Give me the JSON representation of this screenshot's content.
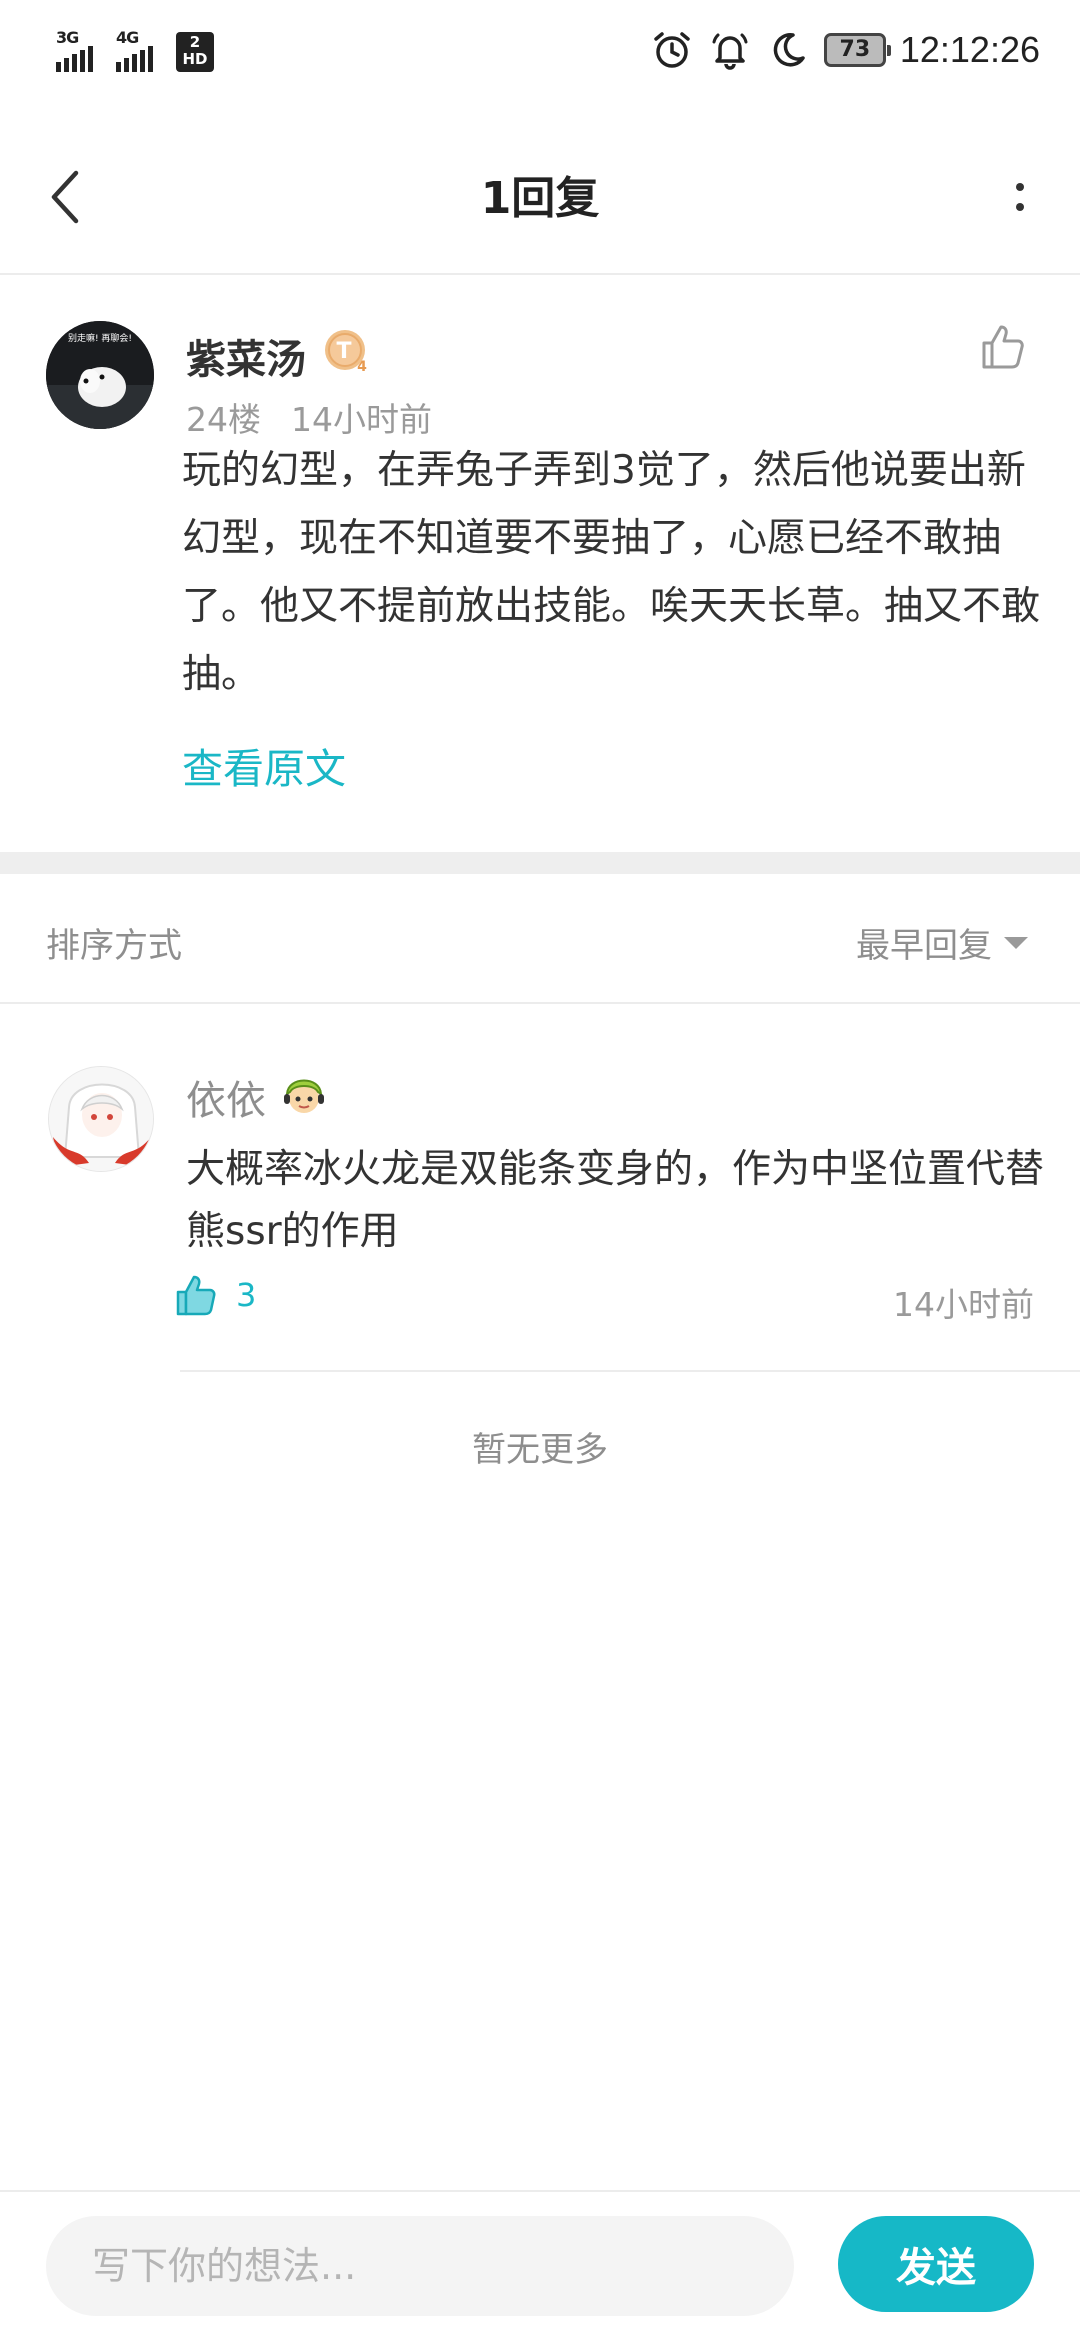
{
  "status_bar": {
    "network_1": "3G",
    "network_2": "4G",
    "sim_badge_top": "2",
    "sim_badge_bottom": "HD",
    "battery": "73",
    "time": "12:12:26",
    "icons": [
      "alarm-icon",
      "bell-icon",
      "moon-icon",
      "battery-icon"
    ]
  },
  "header": {
    "title": "1回复",
    "back_icon": "chevron-left-icon",
    "more_icon": "more-vertical-icon"
  },
  "post": {
    "author": "紫菜汤",
    "level_badge": "T",
    "level_badge_sub": "4",
    "avatar_text": "别走嘛! 再聊会!",
    "floor": "24楼",
    "time": "14小时前",
    "body": "玩的幻型，在弄兔子弄到3觉了，然后他说要出新幻型，现在不知道要不要抽了，心愿已经不敢抽了。他又不提前放出技能。唉天天长草。抽又不敢抽。",
    "view_original": "查看原文"
  },
  "sort": {
    "label": "排序方式",
    "selected": "最早回复"
  },
  "replies": [
    {
      "author": "依依",
      "body": "大概率冰火龙是双能条变身的，作为中坚位置代替熊ssr的作用",
      "likes": "3",
      "time": "14小时前"
    }
  ],
  "no_more": "暂无更多",
  "composer": {
    "placeholder": "写下你的想法...",
    "send_label": "发送"
  },
  "colors": {
    "accent": "#16b8c7",
    "text": "#333333",
    "muted": "#9a9a9a",
    "divider": "#ececec"
  }
}
